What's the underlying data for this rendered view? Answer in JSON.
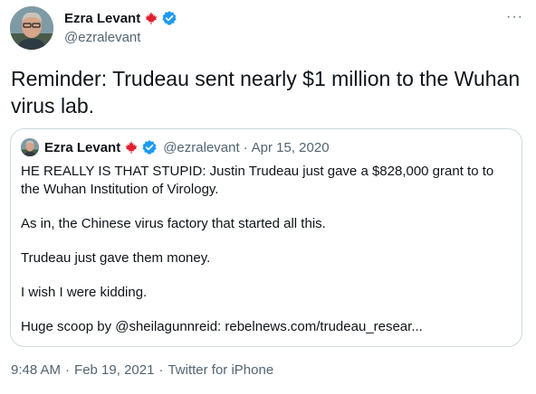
{
  "tweet": {
    "author": {
      "name": "Ezra Levant",
      "handle": "@ezralevant"
    },
    "more_label": "···",
    "text": "Reminder: Trudeau sent nearly $1 million to the Wuhan virus lab.",
    "quoted": {
      "name": "Ezra Levant",
      "handle": "@ezralevant",
      "separator": "·",
      "date": "Apr 15, 2020",
      "paragraphs": [
        "HE REALLY IS THAT STUPID: Justin Trudeau just gave a $828,000 grant to to the Wuhan Institution of Virology.",
        "As in, the Chinese virus factory that started all this.",
        "Trudeau just gave them money.",
        "I wish I were kidding.",
        "Huge scoop by @sheilagunnreid: rebelnews.com/trudeau_resear..."
      ]
    },
    "meta": {
      "time": "9:48 AM",
      "date": "Feb 19, 2021",
      "source": "Twitter for iPhone",
      "separator": "·"
    }
  },
  "colors": {
    "verified": "#1d9bf0",
    "maple_leaf": "#e0202e",
    "secondary_text": "#536471",
    "border": "#cfd9de"
  },
  "icons": {
    "verified": "verified-badge-icon",
    "flag": "maple-leaf-icon",
    "more": "more-options-icon"
  }
}
